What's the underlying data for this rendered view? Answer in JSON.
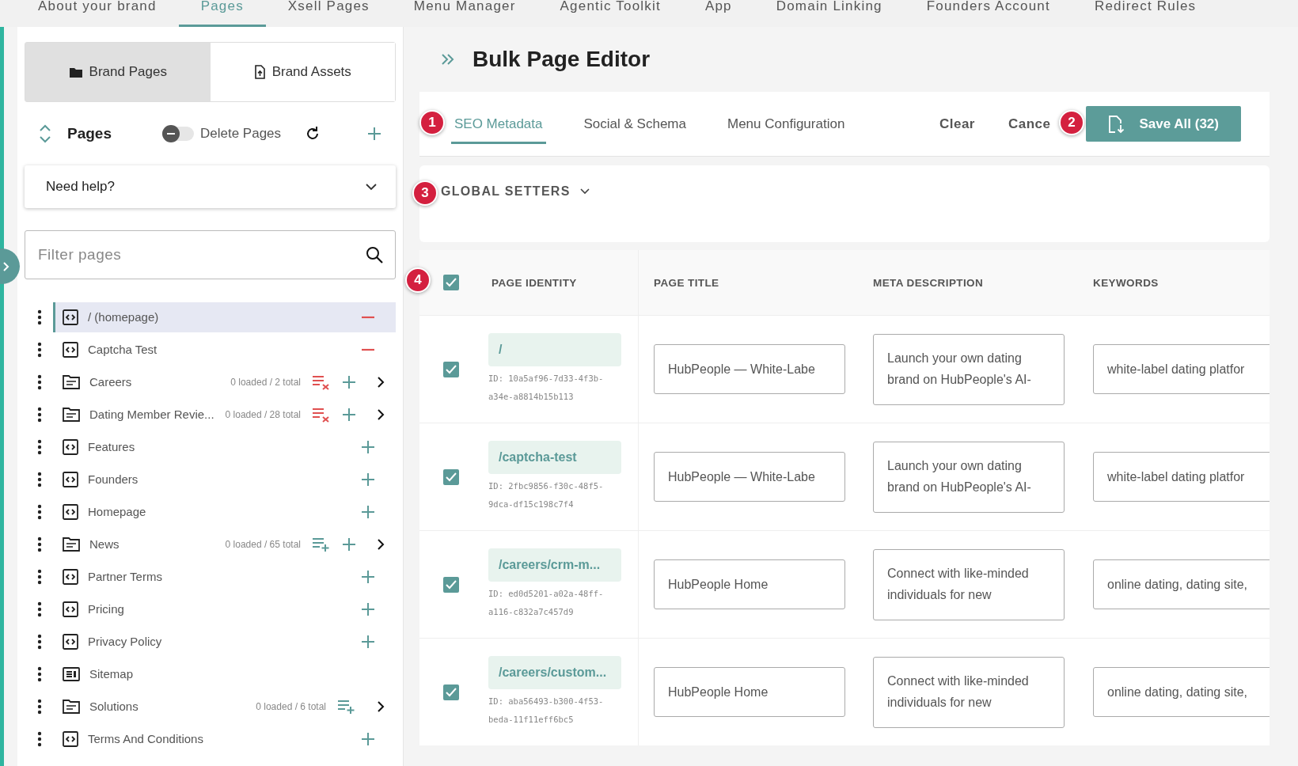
{
  "top_nav": [
    {
      "label": "About your brand",
      "selected": false
    },
    {
      "label": "Pages",
      "selected": true
    },
    {
      "label": "Xsell Pages",
      "selected": false
    },
    {
      "label": "Menu Manager",
      "selected": false
    },
    {
      "label": "Agentic Toolkit",
      "selected": false
    },
    {
      "label": "App",
      "selected": false
    },
    {
      "label": "Domain Linking",
      "selected": false
    },
    {
      "label": "Founders Account",
      "selected": false
    },
    {
      "label": "Redirect Rules",
      "selected": false
    }
  ],
  "sidebar": {
    "switcher": [
      {
        "label": "Brand Pages",
        "kind": "folder",
        "selected": true
      },
      {
        "label": "Brand Assets",
        "kind": "file",
        "selected": false
      }
    ],
    "heading": "Pages",
    "delete_toggle": {
      "label": "Delete Pages",
      "on": false
    },
    "help": "Need help?",
    "filter": {
      "placeholder": "Filter pages"
    },
    "items": [
      {
        "label": "/ (homepage)",
        "kind": "page",
        "selected": true,
        "removable": true,
        "addable": false
      },
      {
        "label": "Captcha Test",
        "kind": "page",
        "selected": false,
        "removable": true,
        "addable": false
      },
      {
        "label": "Careers",
        "kind": "folder",
        "selected": false,
        "count": "0 loaded / 2 total",
        "clearable": true,
        "removable": false,
        "addable": true
      },
      {
        "label": "Dating Member Revie...",
        "kind": "folder",
        "selected": false,
        "count": "0 loaded / 28 total",
        "clearable": true,
        "removable": false,
        "addable": true
      },
      {
        "label": "Features",
        "kind": "page",
        "selected": false,
        "removable": false,
        "addable": true
      },
      {
        "label": "Founders",
        "kind": "page",
        "selected": false,
        "removable": false,
        "addable": true
      },
      {
        "label": "Homepage",
        "kind": "page",
        "selected": false,
        "removable": false,
        "addable": true
      },
      {
        "label": "News",
        "kind": "folder",
        "selected": false,
        "count": "0 loaded / 65 total",
        "clearable": false,
        "removable": false,
        "addable": true
      },
      {
        "label": "Partner Terms",
        "kind": "page",
        "selected": false,
        "removable": false,
        "addable": true
      },
      {
        "label": "Pricing",
        "kind": "page",
        "selected": false,
        "removable": false,
        "addable": true
      },
      {
        "label": "Privacy Policy",
        "kind": "page",
        "selected": false,
        "removable": false,
        "addable": true
      },
      {
        "label": "Sitemap",
        "kind": "sitemap",
        "selected": false,
        "removable": false,
        "addable": false
      },
      {
        "label": "Solutions",
        "kind": "folder",
        "selected": false,
        "count": "0 loaded / 6 total",
        "clearable": false,
        "removable": false,
        "addable": false
      },
      {
        "label": "Terms And Conditions",
        "kind": "page",
        "selected": false,
        "removable": false,
        "addable": true
      }
    ]
  },
  "editor": {
    "title": "Bulk Page Editor",
    "tabs": [
      {
        "label": "SEO Metadata",
        "selected": true
      },
      {
        "label": "Social & Schema",
        "selected": false
      },
      {
        "label": "Menu Configuration",
        "selected": false
      }
    ],
    "actions": {
      "clear": "Clear",
      "cancel": "Cance",
      "save": "Save All (32)"
    },
    "global_setters": "GLOBAL SETTERS",
    "markers": [
      "1",
      "2",
      "3",
      "4"
    ],
    "select_all": {
      "checked": true
    },
    "columns": [
      "PAGE IDENTITY",
      "PAGE TITLE",
      "META DESCRIPTION",
      "KEYWORDS"
    ],
    "rows": [
      {
        "checked": true,
        "path": "/",
        "id_lines": [
          "ID: 10a5af96-7d33-4f3b-",
          "a34e-a8814b15b113"
        ],
        "title": "HubPeople — White-Labe",
        "description": [
          "Launch your own dating",
          "brand on HubPeople's AI-"
        ],
        "keywords": "white-label dating platfor"
      },
      {
        "checked": true,
        "path": "/captcha-test",
        "id_lines": [
          "ID: 2fbc9856-f30c-48f5-",
          "9dca-df15c198c7f4"
        ],
        "title": "HubPeople — White-Labe",
        "description": [
          "Launch your own dating",
          "brand on HubPeople's AI-"
        ],
        "keywords": "white-label dating platfor"
      },
      {
        "checked": true,
        "path": "/careers/crm-m...",
        "id_lines": [
          "ID: ed0d5201-a02a-48ff-",
          "a116-c832a7c457d9"
        ],
        "title": "HubPeople Home",
        "description": [
          "Connect with like-minded",
          "individuals for new"
        ],
        "keywords": "online dating, dating site,"
      },
      {
        "checked": true,
        "path": "/careers/custom...",
        "id_lines": [
          "ID: aba56493-b300-4f53-",
          "beda-11f11eff6bc5"
        ],
        "title": "HubPeople Home",
        "description": [
          "Connect with like-minded",
          "individuals for new"
        ],
        "keywords": "online dating, dating site,"
      }
    ]
  }
}
